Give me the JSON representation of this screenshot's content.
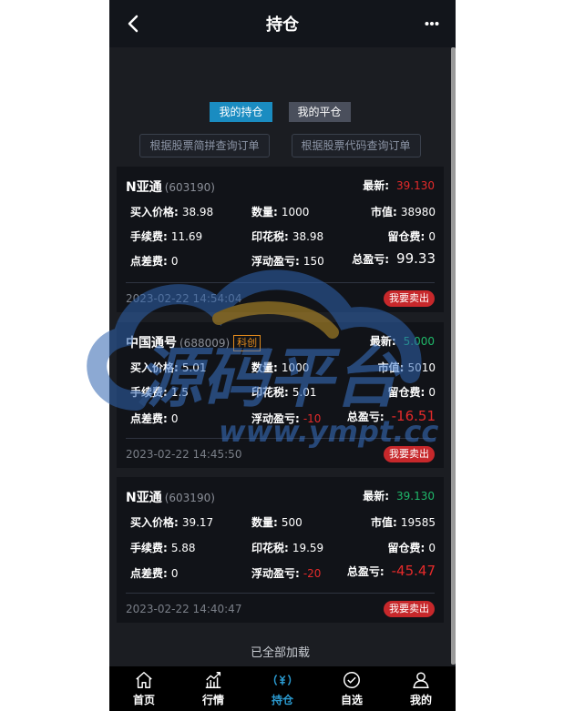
{
  "header": {
    "title": "持仓"
  },
  "tabs": [
    {
      "label": "我的持仓",
      "active": true
    },
    {
      "label": "我的平仓",
      "active": false
    }
  ],
  "filters": [
    {
      "label": "根据股票简拼查询订单"
    },
    {
      "label": "根据股票代码查询订单"
    }
  ],
  "labels": {
    "latest": "最新:",
    "buy_price": "买入价格:",
    "quantity": "数量:",
    "market_value": "市值:",
    "fee": "手续费:",
    "stamp_tax": "印花税:",
    "hold_fee": "留仓费:",
    "spread_fee": "点差费:",
    "float_pl": "浮动盈亏:",
    "total_pl": "总盈亏:",
    "sell": "我要卖出"
  },
  "positions": [
    {
      "name": "N亚通",
      "code": "(603190)",
      "tag": "",
      "latest": "39.130",
      "latest_color": "#e52a2a",
      "buy_price": "38.98",
      "quantity": "1000",
      "market_value": "38980",
      "fee": "11.69",
      "stamp_tax": "38.98",
      "hold_fee": "0",
      "spread_fee": "0",
      "float_pl": "150",
      "total_pl": "99.33",
      "pl_color": "#ffffff",
      "time": "2023-02-22 14:54:04"
    },
    {
      "name": "中国通号",
      "code": "(688009)",
      "tag": "科创",
      "latest": "5.000",
      "latest_color": "#1fb86a",
      "buy_price": "5.01",
      "quantity": "1000",
      "market_value": "5010",
      "fee": "1.5",
      "stamp_tax": "5.01",
      "hold_fee": "0",
      "spread_fee": "0",
      "float_pl": "-10",
      "total_pl": "-16.51",
      "pl_color": "#e52a2a",
      "time": "2023-02-22 14:45:50"
    },
    {
      "name": "N亚通",
      "code": "(603190)",
      "tag": "",
      "latest": "39.130",
      "latest_color": "#1fb86a",
      "buy_price": "39.17",
      "quantity": "500",
      "market_value": "19585",
      "fee": "5.88",
      "stamp_tax": "19.59",
      "hold_fee": "0",
      "spread_fee": "0",
      "float_pl": "-20",
      "total_pl": "-45.47",
      "pl_color": "#e52a2a",
      "time": "2023-02-22 14:40:47"
    }
  ],
  "status": {
    "loaded_all": "已全部加载"
  },
  "watermark": {
    "text": "源码平台",
    "url": "www.ympt.cc"
  },
  "nav": [
    {
      "label": "首页",
      "icon": "home-icon",
      "active": false
    },
    {
      "label": "行情",
      "icon": "chart-icon",
      "active": false
    },
    {
      "label": "持仓",
      "icon": "yen-icon",
      "active": true
    },
    {
      "label": "自选",
      "icon": "check-circle-icon",
      "active": false
    },
    {
      "label": "我的",
      "icon": "user-icon",
      "active": false
    }
  ],
  "colors": {
    "accent": "#1a8cc1",
    "nav_active": "#2b9bd1",
    "sell": "#c7282b",
    "down": "#1fb86a",
    "up": "#e52a2a"
  }
}
